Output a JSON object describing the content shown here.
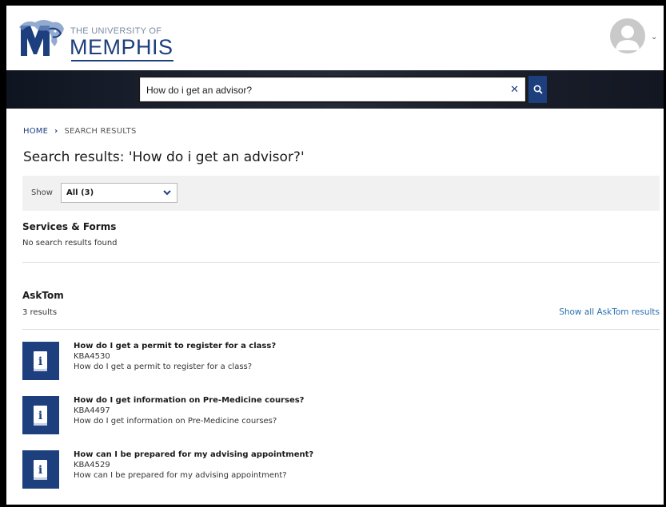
{
  "header": {
    "logo_small": "THE UNIVERSITY OF",
    "logo_big": "MEMPHIS",
    "logo_icon": "tiger-icon",
    "avatar_icon": "user-avatar-icon",
    "caret_icon": "chevron-down-icon"
  },
  "search": {
    "value": "How do i get an advisor?",
    "clear_icon": "close-icon",
    "search_icon": "search-icon"
  },
  "breadcrumb": {
    "home": "HOME",
    "separator": "›",
    "current": "SEARCH RESULTS"
  },
  "page": {
    "title": "Search results: 'How do i get an advisor?'"
  },
  "filter": {
    "label": "Show",
    "selected": "All (3)"
  },
  "services": {
    "title": "Services & Forms",
    "empty": "No search results found"
  },
  "asktom": {
    "title": "AskTom",
    "count": "3 results",
    "show_all": "Show all AskTom results",
    "results": [
      {
        "title": "How do I get a permit to register for a class?",
        "id": "KBA4530",
        "desc": "How do I get a permit to register for a class?"
      },
      {
        "title": "How do I get information on Pre-Medicine courses?",
        "id": "KBA4497",
        "desc": "How do I get information on Pre-Medicine courses?"
      },
      {
        "title": "How can I be prepared for my advising appointment?",
        "id": "KBA4529",
        "desc": "How can I be prepared for my advising appointment?"
      }
    ]
  },
  "colors": {
    "brand_blue": "#1d3f7e",
    "link_blue": "#2a6fb0"
  }
}
